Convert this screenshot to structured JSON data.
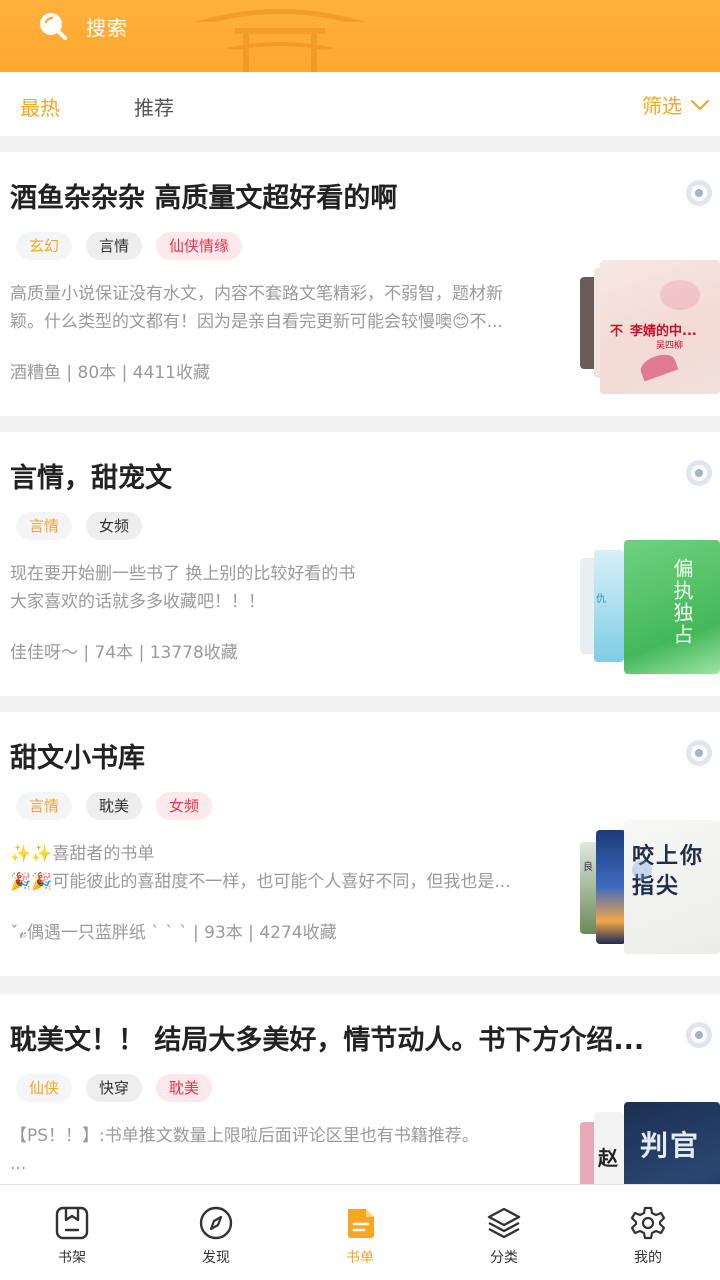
{
  "search": {
    "label": "搜索"
  },
  "filter_tabs": [
    {
      "label": "最热",
      "active": true
    },
    {
      "label": "推荐",
      "active": false
    }
  ],
  "filter_button": {
    "label": "筛选"
  },
  "cards": [
    {
      "title": "酒鱼杂杂杂 高质量文超好看的啊",
      "tags": [
        {
          "label": "玄幻",
          "style": "orange"
        },
        {
          "label": "言情",
          "style": "gray"
        },
        {
          "label": "仙侠情缘",
          "style": "red"
        }
      ],
      "desc": [
        "高质量小说保证没有水文，内容不套路文笔精彩，不弱智，题材新",
        "颖。什么类型的文都有！因为是亲自看完更新可能会较慢噢😊不..."
      ],
      "meta": "酒糟鱼 | 80本 | 4411收藏",
      "cover_text": [
        "不",
        "李婧的中...",
        "吴四柳"
      ]
    },
    {
      "title": "言情，甜宠文",
      "tags": [
        {
          "label": "言情",
          "style": "orange"
        },
        {
          "label": "女频",
          "style": "gray"
        }
      ],
      "desc": [
        "现在要开始删一些书了 换上别的比较好看的书",
        "大家喜欢的话就多多收藏吧！！！"
      ],
      "meta": "佳佳呀～ | 74本 | 13778收藏",
      "cover_text": [
        "偏执独占",
        "仇"
      ]
    },
    {
      "title": "甜文小书库",
      "tags": [
        {
          "label": "言情",
          "style": "orange"
        },
        {
          "label": "耽美",
          "style": "gray"
        },
        {
          "label": "女频",
          "style": "red"
        }
      ],
      "desc": [
        "✨✨喜甜者的书单",
        "🎉🎉可能彼此的喜甜度不一样，也可能个人喜好不同，但我也是..."
      ],
      "meta": "ˇ𝓋偶遇一只蓝胖纸 ˋ ˋ ˋ | 93本 | 4274收藏",
      "cover_text": [
        "咬上你指尖",
        "良"
      ]
    },
    {
      "title": "耽美文！！ 结局大多美好，情节动人。书下方介绍...",
      "tags": [
        {
          "label": "仙侠",
          "style": "orange"
        },
        {
          "label": "快穿",
          "style": "gray"
        },
        {
          "label": "耽美",
          "style": "red"
        }
      ],
      "desc": [
        "【PS！！】:书单推文数量上限啦后面评论区里也有书籍推荐。",
        "..."
      ],
      "meta": "",
      "cover_text": [
        "判官",
        "赵"
      ]
    }
  ],
  "bottom_nav": [
    {
      "label": "书架",
      "icon": "bookshelf-icon",
      "active": false
    },
    {
      "label": "发现",
      "icon": "compass-icon",
      "active": false
    },
    {
      "label": "书单",
      "icon": "booklist-icon",
      "active": true
    },
    {
      "label": "分类",
      "icon": "layers-icon",
      "active": false
    },
    {
      "label": "我的",
      "icon": "gear-icon",
      "active": false
    }
  ],
  "colors": {
    "accent": "#f5a623",
    "header": "#ffad36",
    "tag_red": "#e8334a"
  }
}
